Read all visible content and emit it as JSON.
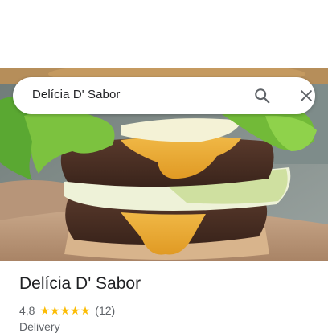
{
  "search": {
    "query": "Delícia D' Sabor",
    "search_icon": "search-icon",
    "close_icon": "close-icon"
  },
  "hero_image": {
    "subject": "double cheeseburger with lettuce, cheese and sauce on a wooden board"
  },
  "place": {
    "name": "Delícia D' Sabor",
    "rating": "4,8",
    "rating_value": 4.8,
    "stars_max": 5,
    "review_count": "(12)",
    "category": "Delivery"
  },
  "colors": {
    "star": "#fbbc04",
    "text_primary": "#202124",
    "text_secondary": "#5f6368"
  }
}
